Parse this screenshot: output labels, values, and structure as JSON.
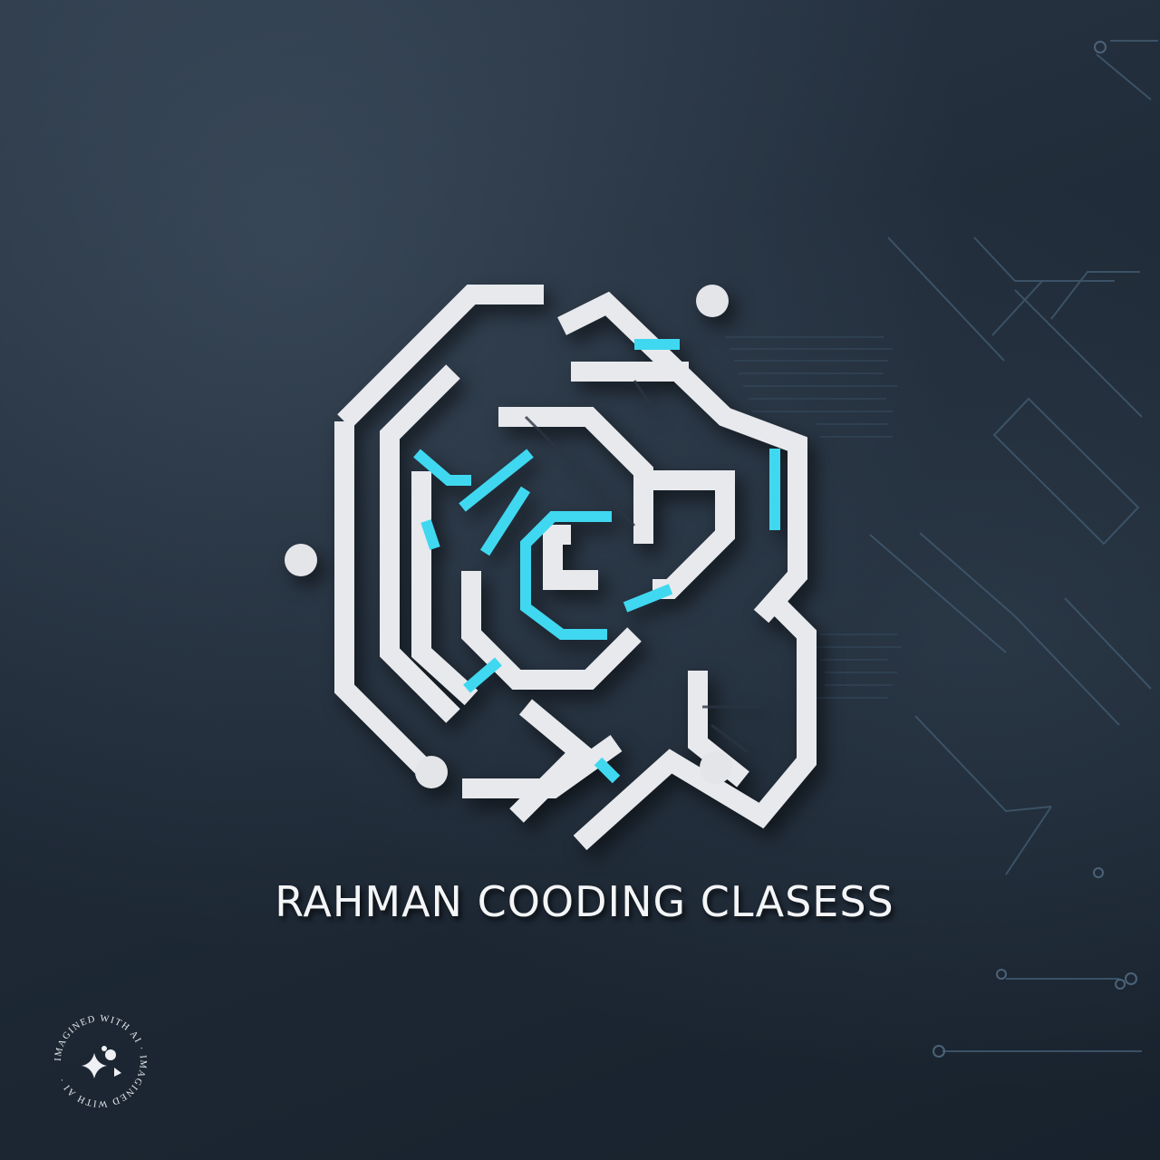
{
  "brand": {
    "name": "RAHMAN COODING CLASESS"
  },
  "badge": {
    "ring_text": "IMAGINED WITH AI · IMAGINED WITH AI · ",
    "icon": "sparkle-icon"
  },
  "colors": {
    "background": "#1f2b38",
    "logo_silver": "#e6e8ec",
    "logo_accent": "#3fd8f0",
    "circuit_lines": "#3c5266"
  }
}
